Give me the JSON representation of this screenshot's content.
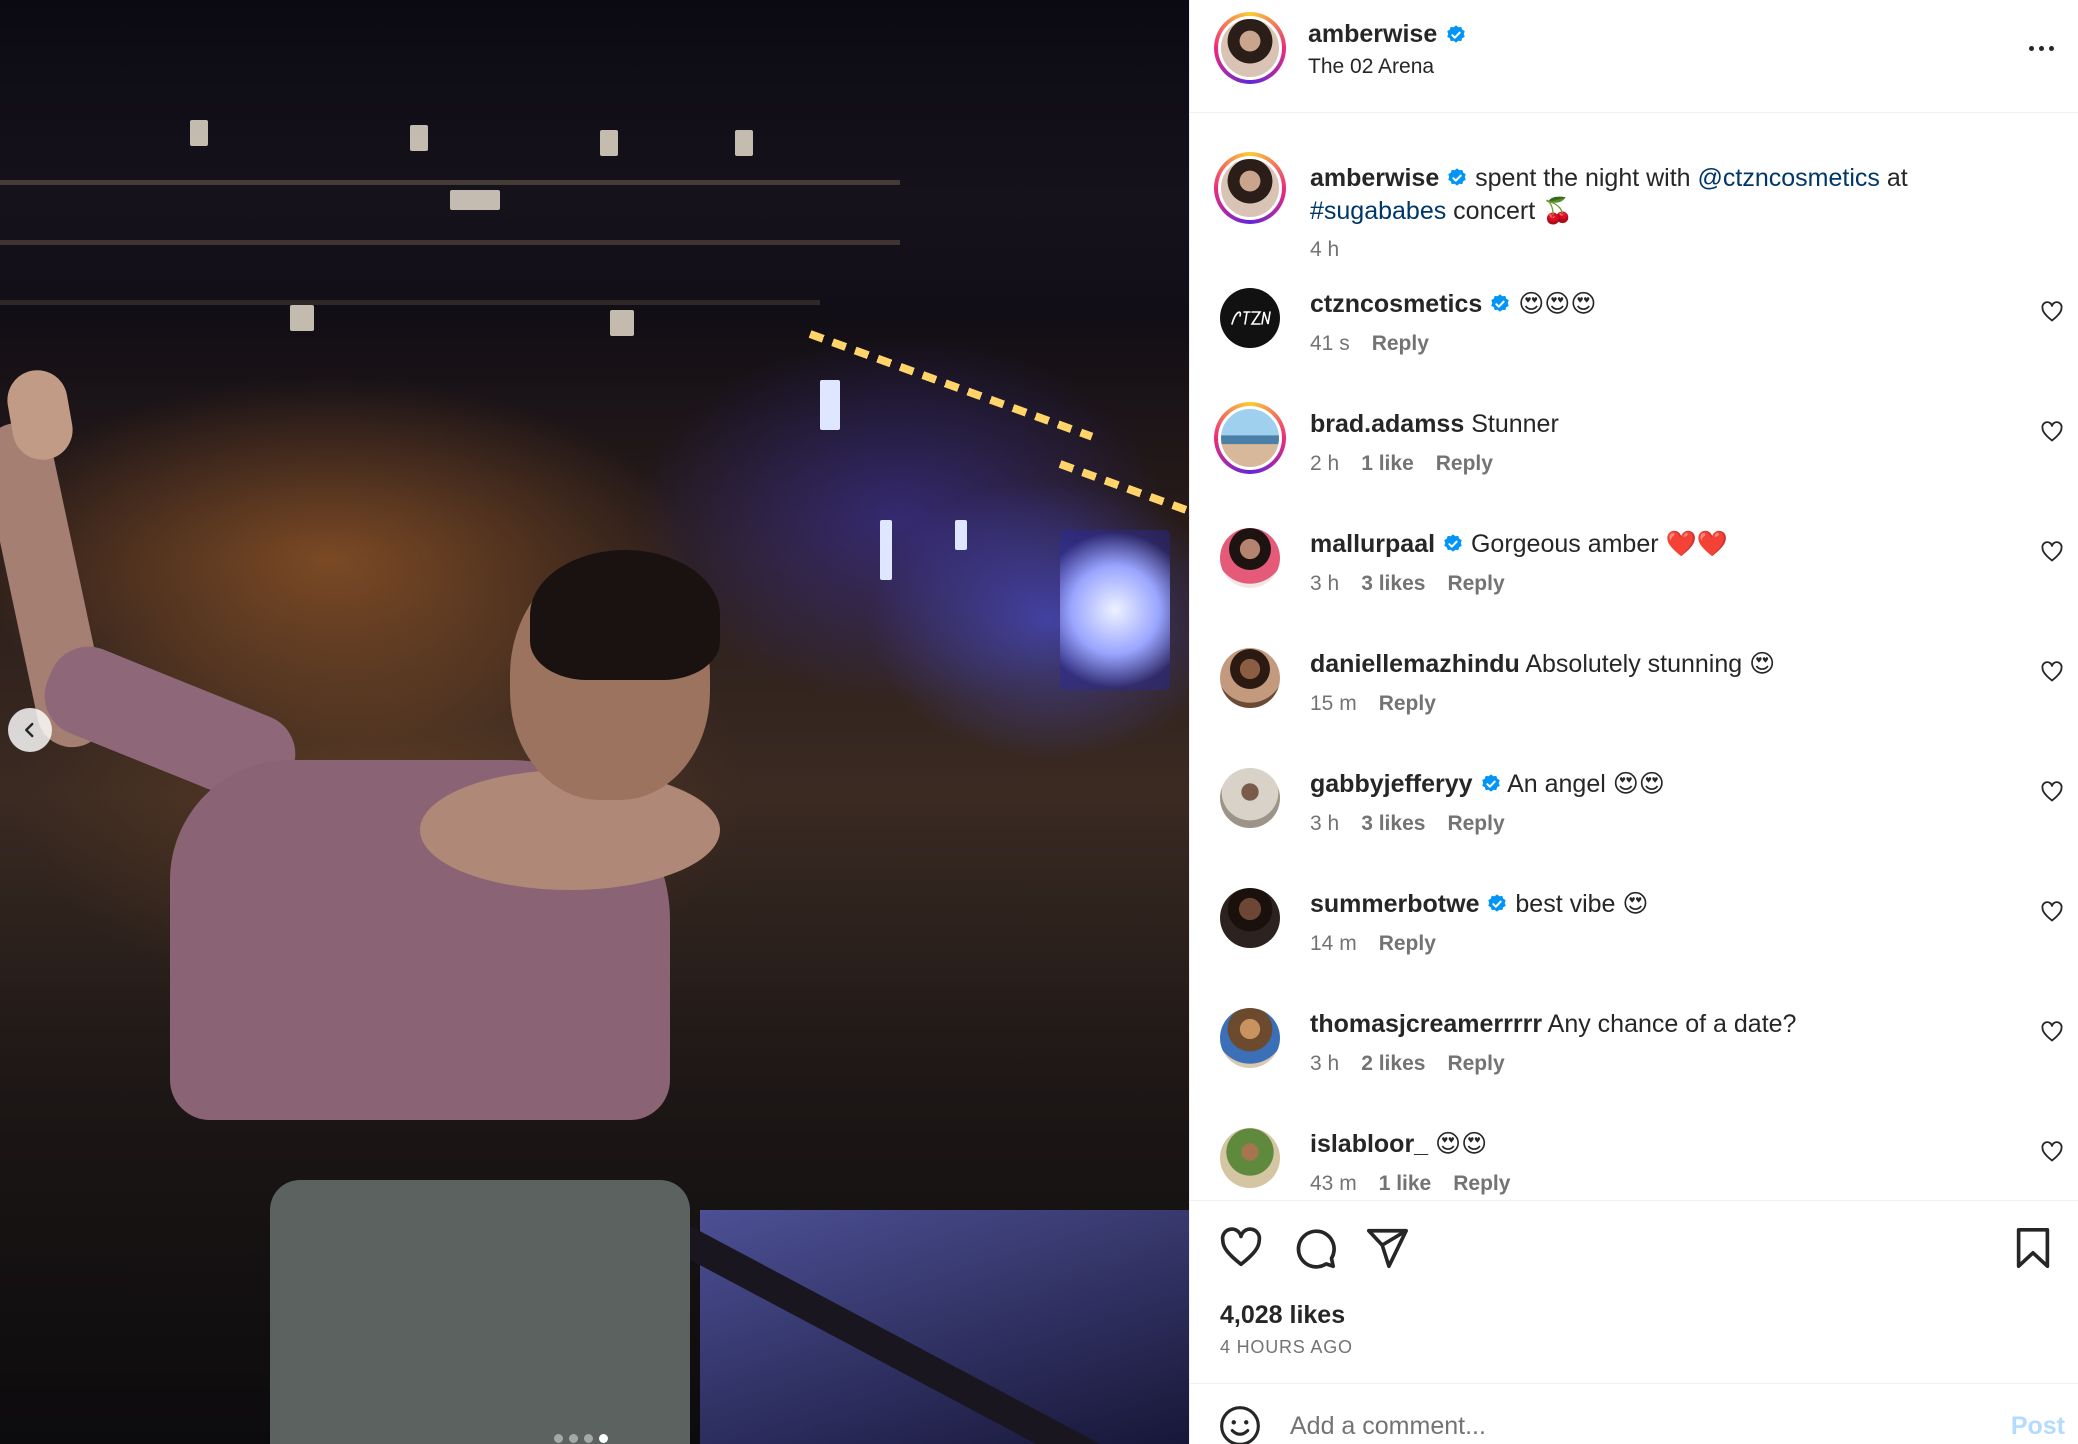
{
  "post": {
    "username": "amberwise",
    "location": "The 02 Arena",
    "caption_user": "amberwise",
    "caption_text_1": " spent the night with ",
    "caption_mention": "@ctzncosmetics",
    "caption_text_2": " at ",
    "caption_hashtag": "#sugababes",
    "caption_text_3": " concert 🍒",
    "caption_time": "4 h",
    "likes": "4,028 likes",
    "time_ago": "4 HOURS AGO"
  },
  "comments": [
    {
      "user": "ctzncosmetics",
      "verified": true,
      "text": "😍😍😍",
      "time": "41 s",
      "likes": "",
      "reply": "Reply"
    },
    {
      "user": "brad.adamss",
      "verified": false,
      "text": "Stunner",
      "time": "2 h",
      "likes": "1 like",
      "reply": "Reply"
    },
    {
      "user": "mallurpaal",
      "verified": true,
      "text": "Gorgeous amber ❤️❤️",
      "time": "3 h",
      "likes": "3 likes",
      "reply": "Reply"
    },
    {
      "user": "daniellemazhindu",
      "verified": false,
      "text": "Absolutely stunning 😍",
      "time": "15 m",
      "likes": "",
      "reply": "Reply"
    },
    {
      "user": "gabbyjefferyy",
      "verified": true,
      "text": "An angel 😍😍",
      "time": "3 h",
      "likes": "3 likes",
      "reply": "Reply"
    },
    {
      "user": "summerbotwe",
      "verified": true,
      "text": "best vibe 😍",
      "time": "14 m",
      "likes": "",
      "reply": "Reply"
    },
    {
      "user": "thomasjcreamerrrrr",
      "verified": false,
      "text": "Any chance of a date?",
      "time": "3 h",
      "likes": "2 likes",
      "reply": "Reply"
    },
    {
      "user": "islabloor_",
      "verified": false,
      "text": "😍😍",
      "time": "43 m",
      "likes": "1 like",
      "reply": "Reply"
    }
  ],
  "composer": {
    "placeholder": "Add a comment...",
    "post_label": "Post"
  },
  "icons": {
    "more": "more-horizontal-icon",
    "like": "heart-icon",
    "comment": "comment-bubble-icon",
    "share": "paper-plane-icon",
    "save": "bookmark-icon",
    "emoji": "emoji-smile-icon",
    "prev": "chevron-left-icon",
    "verified": "verified-badge-icon"
  },
  "carousel": {
    "total_slides": 4,
    "active_slide": 4
  },
  "colors": {
    "link": "#00376b",
    "verified": "#0095f6",
    "muted": "#737373",
    "post_disabled": "#b3dbff"
  }
}
